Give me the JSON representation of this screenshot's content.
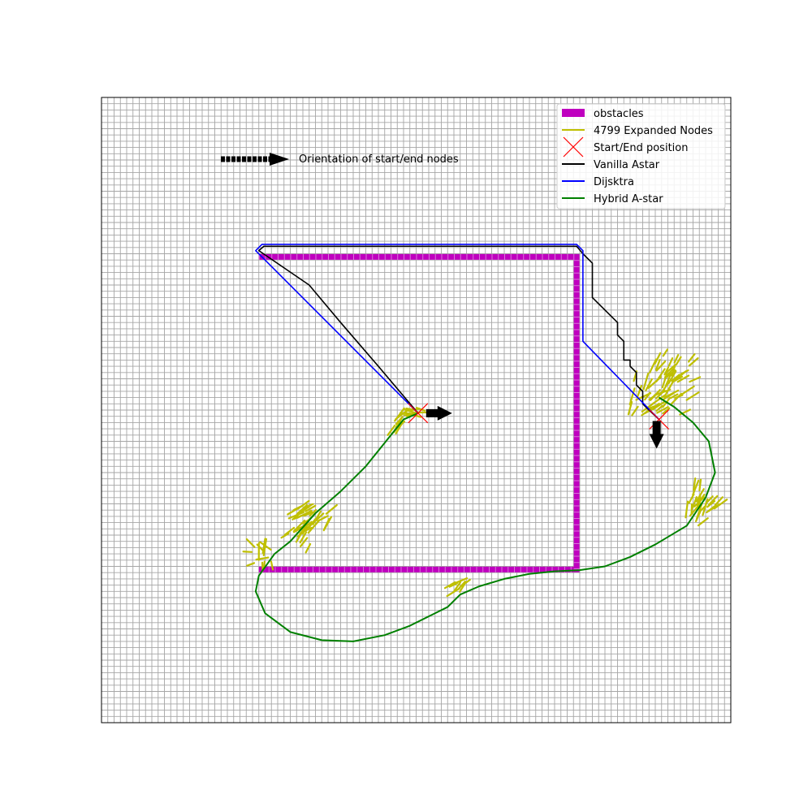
{
  "chart_data": {
    "type": "line",
    "title": "",
    "xlabel": "",
    "ylabel": "",
    "xlim": [
      0,
      100
    ],
    "ylim": [
      0,
      100
    ],
    "grid": true,
    "legend_placement": "top-right",
    "annotation": "Orientation of start/end nodes",
    "series": [
      {
        "name": "obstacles",
        "kind": "thick-wall",
        "color": "#bf00bf",
        "points": [
          [
            25,
            74.5
          ],
          [
            75.5,
            74.5
          ],
          [
            75.5,
            24.5
          ],
          [
            25,
            24.5
          ]
        ]
      },
      {
        "name": "4799 Expanded Nodes",
        "kind": "segments",
        "color": "#bfbf00",
        "points": []
      },
      {
        "name": "Start/End position",
        "kind": "markers",
        "color": "#ff0000",
        "points": [
          [
            50.3,
            49.5
          ],
          [
            88.6,
            48.5
          ]
        ]
      },
      {
        "name": "Vanilla Astar",
        "color": "#000000",
        "points": [
          [
            50.3,
            49.5
          ],
          [
            44,
            57
          ],
          [
            38,
            64
          ],
          [
            33,
            70
          ],
          [
            25,
            75.5
          ],
          [
            25.8,
            76.2
          ],
          [
            75.5,
            76.2
          ],
          [
            76.5,
            75
          ],
          [
            78,
            73.5
          ],
          [
            78,
            68
          ],
          [
            80,
            66
          ],
          [
            82,
            64
          ],
          [
            82,
            62
          ],
          [
            83,
            61
          ],
          [
            83,
            58
          ],
          [
            84,
            58
          ],
          [
            84,
            57
          ],
          [
            85,
            56
          ],
          [
            85,
            54
          ],
          [
            86,
            53
          ],
          [
            86,
            51
          ],
          [
            87,
            50
          ],
          [
            88.6,
            48.5
          ]
        ]
      },
      {
        "name": "Dijsktra",
        "color": "#0000ff",
        "points": [
          [
            50.3,
            49.5
          ],
          [
            24.5,
            75.5
          ],
          [
            25.5,
            76.5
          ],
          [
            75.5,
            76.5
          ],
          [
            76.5,
            75.5
          ],
          [
            76.5,
            61
          ],
          [
            88.6,
            48.5
          ]
        ]
      },
      {
        "name": "Hybrid A-star",
        "color": "#008000",
        "points": [
          [
            50.3,
            49.5
          ],
          [
            48,
            48.5
          ],
          [
            46,
            46
          ],
          [
            42,
            41
          ],
          [
            38,
            37
          ],
          [
            34,
            33.5
          ],
          [
            30,
            29
          ],
          [
            27.5,
            27
          ],
          [
            25,
            23.5
          ],
          [
            24.5,
            21
          ],
          [
            26,
            17.5
          ],
          [
            30,
            14.5
          ],
          [
            35,
            13.2
          ],
          [
            40,
            13
          ],
          [
            45,
            14
          ],
          [
            49,
            15.5
          ],
          [
            53,
            17.5
          ],
          [
            55,
            18.5
          ],
          [
            57,
            20.5
          ],
          [
            60,
            21.8
          ],
          [
            64,
            23
          ],
          [
            68,
            23.8
          ],
          [
            72,
            24.2
          ],
          [
            76,
            24.4
          ],
          [
            80,
            25
          ],
          [
            84,
            26.5
          ],
          [
            88,
            28.5
          ],
          [
            93,
            31.5
          ],
          [
            96,
            36
          ],
          [
            97.5,
            40
          ],
          [
            96.5,
            45
          ],
          [
            94,
            48
          ],
          [
            91,
            50.5
          ],
          [
            88.6,
            52
          ]
        ]
      }
    ],
    "expanded_clusters": [
      {
        "origin": [
          50.3,
          49.5
        ],
        "radius": 2.5,
        "angle": [
          150,
          210
        ],
        "count": 10
      },
      {
        "origin": [
          48,
          49
        ],
        "radius": 4,
        "angle": [
          215,
          240
        ],
        "count": 8
      },
      {
        "origin": [
          36,
          35
        ],
        "radius": 8,
        "angle": [
          200,
          245
        ],
        "count": 40
      },
      {
        "origin": [
          26,
          27
        ],
        "radius": 4,
        "angle": [
          60,
          300
        ],
        "count": 12
      },
      {
        "origin": [
          58,
          23
        ],
        "radius": 4,
        "angle": [
          200,
          240
        ],
        "count": 8
      },
      {
        "origin": [
          86,
          49.5
        ],
        "radius": 11,
        "angle": [
          20,
          75
        ],
        "count": 60
      },
      {
        "origin": [
          94,
          33
        ],
        "radius": 6,
        "angle": [
          30,
          90
        ],
        "count": 25
      }
    ]
  }
}
